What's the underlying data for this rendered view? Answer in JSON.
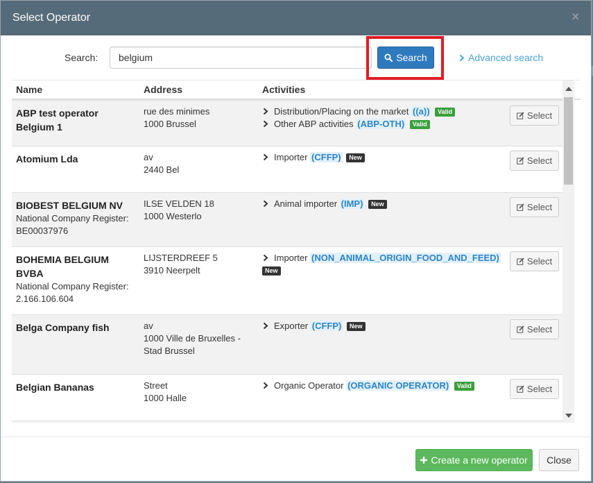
{
  "modal": {
    "title": "Select Operator",
    "close_glyph": "×"
  },
  "search": {
    "label": "Search:",
    "value": "belgium",
    "button_label": "Search",
    "advanced_label": "Advanced search"
  },
  "table": {
    "headers": {
      "name": "Name",
      "address": "Address",
      "activities": "Activities"
    },
    "select_label": "Select",
    "rows": [
      {
        "name": "ABP test operator Belgium 1",
        "name_sub": "",
        "address": [
          "rue des minimes",
          "1000 Brussel"
        ],
        "activities": [
          {
            "label": "Distribution/Placing on the market",
            "code": "((a))",
            "status": "Valid"
          },
          {
            "label": "Other ABP activities",
            "code": "(ABP-OTH)",
            "status": "Valid"
          }
        ]
      },
      {
        "name": "Atomium Lda",
        "name_sub": "",
        "address": [
          "av",
          "2440 Bel"
        ],
        "activities": [
          {
            "label": "Importer",
            "code": "(CFFP)",
            "status": "New"
          }
        ]
      },
      {
        "name": "BIOBEST BELGIUM NV",
        "name_sub": "National Company Register: BE00037976",
        "address": [
          "ILSE VELDEN 18",
          "1000 Westerlo"
        ],
        "activities": [
          {
            "label": "Animal importer",
            "code": "(IMP)",
            "status": "New"
          }
        ]
      },
      {
        "name": "BOHEMIA BELGIUM BVBA",
        "name_sub": "National Company Register: 2.166.106.604",
        "address": [
          "LIJSTERDREEF 5",
          "3910 Neerpelt"
        ],
        "activities": [
          {
            "label": "Importer",
            "code": "(NON_ANIMAL_ORIGIN_FOOD_AND_FEED)",
            "status": "New"
          }
        ]
      },
      {
        "name": "Belga Company fish",
        "name_sub": "",
        "address": [
          "av",
          "1000 Ville de Bruxelles - Stad Brussel"
        ],
        "activities": [
          {
            "label": "Exporter",
            "code": "(CFFP)",
            "status": "New"
          }
        ]
      },
      {
        "name": "Belgian Bananas",
        "name_sub": "",
        "address": [
          "Street",
          "1000 Halle"
        ],
        "activities": [
          {
            "label": "Organic Operator",
            "code": "(ORGANIC OPERATOR)",
            "status": "Valid"
          }
        ]
      }
    ]
  },
  "footer": {
    "create_label": "Create a new operator",
    "close_label": "Close"
  },
  "colors": {
    "header_bg": "#566b79",
    "primary": "#2f7abf",
    "success": "#5cb85c",
    "highlight": "#e21b23",
    "link": "#4aa3d8",
    "badge_valid": "#3b9e3b",
    "badge_new": "#333333"
  },
  "icons": {
    "search_button": "search-icon",
    "advanced": "chevron-right-icon",
    "activity": "chevron-right-icon",
    "select": "edit-icon",
    "create": "plus-icon",
    "scroll_up": "triangle-up-icon",
    "scroll_down": "triangle-down-icon"
  }
}
